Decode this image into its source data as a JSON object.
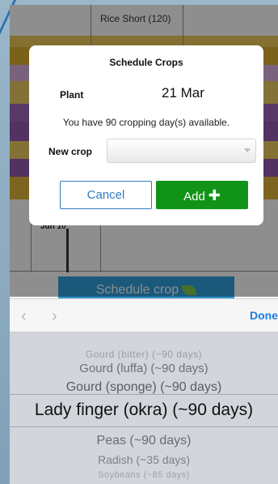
{
  "calendar": {
    "cell_label": "Rice Short (120)",
    "date_label": "Jun 10",
    "schedule_button": "Schedule crop"
  },
  "dialog": {
    "title": "Schedule Crops",
    "plant_label": "Plant",
    "plant_date": "21 Mar",
    "info": "You have 90 cropping day(s) available.",
    "new_crop_label": "New crop",
    "new_crop_value": "",
    "cancel_label": "Cancel",
    "add_label": "Add",
    "add_icon": "plus-icon"
  },
  "accessory": {
    "prev_icon": "‹",
    "next_icon": "›",
    "done_label": "Done"
  },
  "picker": {
    "items": [
      "Gourd (bitter) (~90 days)",
      "Gourd (luffa) (~90 days)",
      "Gourd (sponge) (~90 days)",
      "Lady finger (okra) (~90 days)",
      "Peas (~90 days)",
      "Radish (~35 days)",
      "Soybeans (~85 days)"
    ],
    "selected": "Lady finger (okra) (~90 days)"
  },
  "colors": {
    "accent_blue": "#2f7cc1",
    "add_green": "#119317",
    "schedule_blue": "#2f99d3",
    "done_blue": "#1a7de2"
  }
}
